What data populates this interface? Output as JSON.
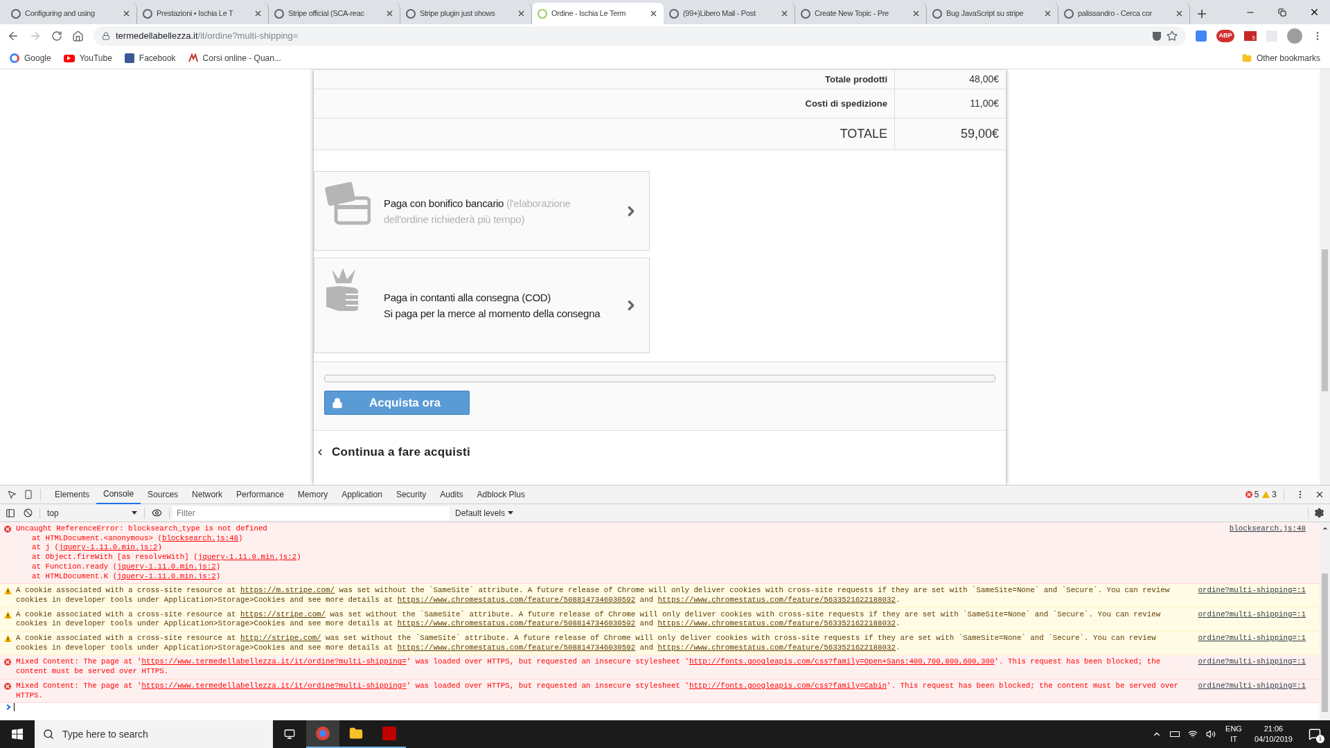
{
  "browser": {
    "tabs": [
      {
        "title": "Configuring and using",
        "selected": false
      },
      {
        "title": "Prestazioni • Ischia Le T",
        "selected": false
      },
      {
        "title": "Stripe official (SCA-reac",
        "selected": false
      },
      {
        "title": "Stripe plugin just shows",
        "selected": false
      },
      {
        "title": "Ordine - Ischia Le Term",
        "selected": true
      },
      {
        "title": "(99+)Libero Mail - Post",
        "selected": false
      },
      {
        "title": "Create New Topic - Pre",
        "selected": false
      },
      {
        "title": "Bug JavaScript su stripe",
        "selected": false
      },
      {
        "title": "palissandro - Cerca cor",
        "selected": false
      }
    ],
    "address": {
      "domain": "termedellabellezza.it",
      "path": "/it/ordine?multi-shipping="
    },
    "extension_badges": [
      "ABP",
      "5"
    ],
    "bookmarks": [
      {
        "label": "Google",
        "kind": "google"
      },
      {
        "label": "YouTube",
        "kind": "youtube"
      },
      {
        "label": "Facebook",
        "kind": "facebook"
      },
      {
        "label": "Corsi online - Quan...",
        "kind": "course"
      }
    ],
    "other_bookmarks": "Other bookmarks"
  },
  "order_summary": [
    {
      "label": "Totale prodotti",
      "value": "48,00€",
      "kind": "line"
    },
    {
      "label": "Costi di spedizione",
      "value": "11,00€",
      "kind": "line"
    },
    {
      "label": "TOTALE",
      "value": "59,00€",
      "kind": "total"
    }
  ],
  "payment_options": [
    {
      "kind": "card",
      "title": "Paga con bonifico bancario",
      "note": "(l'elaborazione dell'ordine richiederà più tempo)"
    },
    {
      "kind": "cash",
      "title": "Paga in contanti alla consegna (COD)",
      "note": "Si paga per la merce al momento della consegna"
    }
  ],
  "buy_button": "Acquista ora",
  "continue_link": "Continua a fare acquisti",
  "devtools": {
    "tabs": [
      {
        "label": "Elements",
        "selected": false
      },
      {
        "label": "Console",
        "selected": true
      },
      {
        "label": "Sources",
        "selected": false
      },
      {
        "label": "Network",
        "selected": false
      },
      {
        "label": "Performance",
        "selected": false
      },
      {
        "label": "Memory",
        "selected": false
      },
      {
        "label": "Application",
        "selected": false
      },
      {
        "label": "Security",
        "selected": false
      },
      {
        "label": "Audits",
        "selected": false
      },
      {
        "label": "Adblock Plus",
        "selected": false
      }
    ],
    "error_count": "5",
    "warning_count": "3",
    "context": "top",
    "filter_placeholder": "Filter",
    "levels": "Default levels",
    "messages": [
      {
        "kind": "error",
        "source": "blocksearch.js:48",
        "parts": [
          {
            "text": "Uncaught ReferenceError: blocksearch_type is not defined",
            "kind": "text"
          }
        ],
        "stack": [
          {
            "before": "at HTMLDocument.<anonymous> (",
            "link": "blocksearch.js:48",
            "after": ")"
          },
          {
            "before": "at j (",
            "link": "jquery-1.11.0.min.js:2",
            "after": ")"
          },
          {
            "before": "at Object.fireWith [as resolveWith] (",
            "link": "jquery-1.11.0.min.js:2",
            "after": ")"
          },
          {
            "before": "at Function.ready (",
            "link": "jquery-1.11.0.min.js:2",
            "after": ")"
          },
          {
            "before": "at HTMLDocument.K (",
            "link": "jquery-1.11.0.min.js:2",
            "after": ")"
          }
        ]
      },
      {
        "kind": "warning",
        "source": "ordine?multi-shipping=:1",
        "parts": [
          {
            "text": "A cookie associated with a cross-site resource at ",
            "kind": "text"
          },
          {
            "text": "https://m.stripe.com/",
            "kind": "link"
          },
          {
            "text": " was set without the `SameSite` attribute. A future release of Chrome will only deliver cookies with cross-site requests if they are set with `SameSite=None` and `Secure`. You can review cookies in developer tools under Application>Storage>Cookies and see more details at ",
            "kind": "text"
          },
          {
            "text": "https://www.chromestatus.com/feature/5088147346030592",
            "kind": "link"
          },
          {
            "text": " and ",
            "kind": "text"
          },
          {
            "text": "https://www.chromestatus.com/feature/5633521622188032",
            "kind": "link"
          },
          {
            "text": ".",
            "kind": "text"
          }
        ]
      },
      {
        "kind": "warning",
        "source": "ordine?multi-shipping=:1",
        "parts": [
          {
            "text": "A cookie associated with a cross-site resource at ",
            "kind": "text"
          },
          {
            "text": "https://stripe.com/",
            "kind": "link"
          },
          {
            "text": " was set without the `SameSite` attribute. A future release of Chrome will only deliver cookies with cross-site requests if they are set with `SameSite=None` and `Secure`. You can review cookies in developer tools under Application>Storage>Cookies and see more details at ",
            "kind": "text"
          },
          {
            "text": "https://www.chromestatus.com/feature/5088147346030592",
            "kind": "link"
          },
          {
            "text": " and ",
            "kind": "text"
          },
          {
            "text": "https://www.chromestatus.com/feature/5633521622188032",
            "kind": "link"
          },
          {
            "text": ".",
            "kind": "text"
          }
        ]
      },
      {
        "kind": "warning",
        "source": "ordine?multi-shipping=:1",
        "parts": [
          {
            "text": "A cookie associated with a cross-site resource at ",
            "kind": "text"
          },
          {
            "text": "http://stripe.com/",
            "kind": "link"
          },
          {
            "text": " was set without the `SameSite` attribute. A future release of Chrome will only deliver cookies with cross-site requests if they are set with `SameSite=None` and `Secure`. You can review cookies in developer tools under Application>Storage>Cookies and see more details at ",
            "kind": "text"
          },
          {
            "text": "https://www.chromestatus.com/feature/5088147346030592",
            "kind": "link"
          },
          {
            "text": " and ",
            "kind": "text"
          },
          {
            "text": "https://www.chromestatus.com/feature/5633521622188032",
            "kind": "link"
          },
          {
            "text": ".",
            "kind": "text"
          }
        ]
      },
      {
        "kind": "error",
        "source": "ordine?multi-shipping=:1",
        "parts": [
          {
            "text": "Mixed Content: The page at '",
            "kind": "text"
          },
          {
            "text": "https://www.termedellabellezza.it/it/ordine?multi-shipping=",
            "kind": "link"
          },
          {
            "text": "' was loaded over HTTPS, but requested an insecure stylesheet '",
            "kind": "text"
          },
          {
            "text": "http://fonts.googleapis.com/css?family=Open+Sans:400,700,800,600,300",
            "kind": "link"
          },
          {
            "text": "'. This request has been blocked; the content must be served over HTTPS.",
            "kind": "text"
          }
        ]
      },
      {
        "kind": "error",
        "source": "ordine?multi-shipping=:1",
        "parts": [
          {
            "text": "Mixed Content: The page at '",
            "kind": "text"
          },
          {
            "text": "https://www.termedellabellezza.it/it/ordine?multi-shipping=",
            "kind": "link"
          },
          {
            "text": "' was loaded over HTTPS, but requested an insecure stylesheet '",
            "kind": "text"
          },
          {
            "text": "http://fonts.googleapis.com/css?family=Cabin",
            "kind": "link"
          },
          {
            "text": "'. This request has been blocked; the content must be served over HTTPS.",
            "kind": "text"
          }
        ]
      }
    ]
  },
  "taskbar": {
    "search_placeholder": "Type here to search",
    "language": "ENG",
    "layout": "IT",
    "time": "21:06",
    "date": "04/10/2019",
    "notifications": "1"
  }
}
